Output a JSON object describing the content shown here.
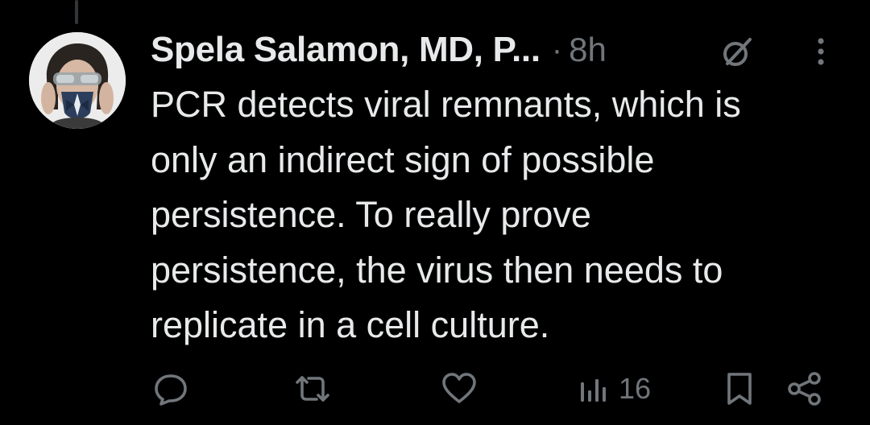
{
  "tweet": {
    "author_name": "Spela Salamon, MD, P...",
    "separator": "·",
    "timestamp": "8h",
    "text": "PCR detects viral remnants, which is\nonly an indirect sign of possible\npersistence. To really prove\npersistence, the virus then needs to\nreplicate in a cell culture."
  },
  "header_icons": [
    "grok-icon",
    "more-vertical-icon"
  ],
  "actions": {
    "reply_icon": "speech-bubble-icon",
    "repost_icon": "repost-arrows-icon",
    "like_icon": "heart-icon",
    "views_icon": "bar-chart-icon",
    "views_count": "16",
    "bookmark_icon": "bookmark-icon",
    "share_icon": "share-nodes-icon"
  },
  "colors": {
    "background": "#000000",
    "text_primary": "#e7e9ea",
    "text_secondary": "#71767b",
    "thread_line": "#333639"
  }
}
